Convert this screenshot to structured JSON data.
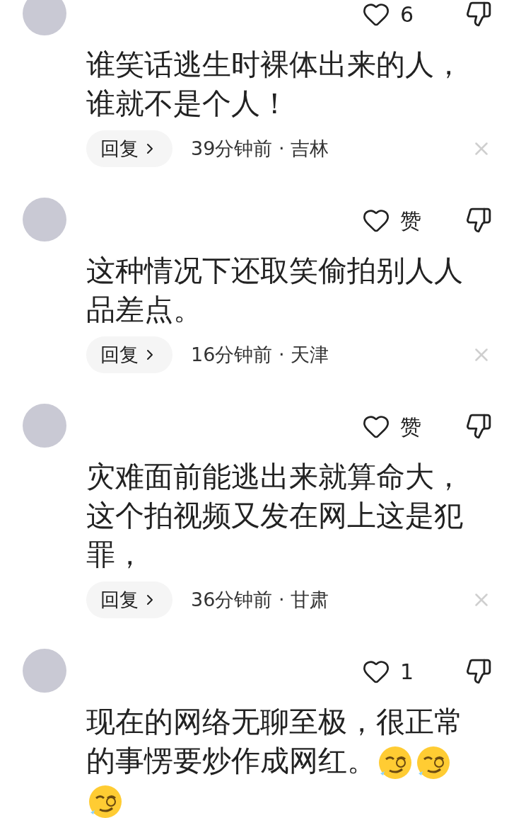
{
  "comments": [
    {
      "likes": "6",
      "text": "谁笑话逃生时裸体出来的人，谁就不是个人！",
      "reply": "回复",
      "time": "39分钟前 · 吉林"
    },
    {
      "likes": "赞",
      "text": "这种情况下还取笑偷拍别人人品差点。",
      "reply": "回复",
      "time": "16分钟前 · 天津"
    },
    {
      "likes": "赞",
      "text": "灾难面前能逃出来就算命大，这个拍视频又发在网上这是犯罪，",
      "reply": "回复",
      "time": "36分钟前 · 甘肃"
    },
    {
      "likes": "1",
      "text": "现在的网络无聊至极，很正常的事愣要炒作成网红。",
      "emojis": [
        {
          "kind": "smirk"
        },
        {
          "kind": "smirk"
        },
        {
          "kind": "smirk"
        }
      ]
    }
  ]
}
